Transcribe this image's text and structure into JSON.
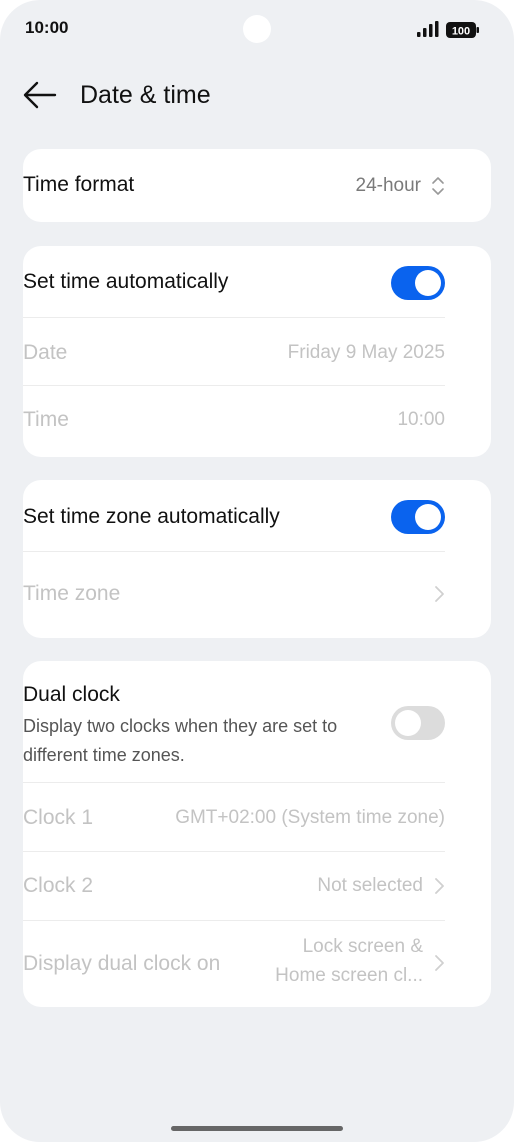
{
  "status_bar": {
    "time": "10:00",
    "battery": "100"
  },
  "header": {
    "title": "Date & time"
  },
  "time_format": {
    "label": "Time format",
    "value": "24-hour"
  },
  "auto_time": {
    "label": "Set time automatically",
    "enabled": true,
    "date_label": "Date",
    "date_value": "Friday 9 May 2025",
    "time_label": "Time",
    "time_value": "10:00"
  },
  "auto_zone": {
    "label": "Set time zone automatically",
    "enabled": true,
    "zone_label": "Time zone"
  },
  "dual_clock": {
    "label": "Dual clock",
    "description": "Display two clocks when they are set to different time zones.",
    "enabled": false,
    "clock1_label": "Clock 1",
    "clock1_value": "GMT+02:00 (System time zone)",
    "clock2_label": "Clock 2",
    "clock2_value": "Not selected",
    "display_label": "Display dual clock on",
    "display_value_line1": "Lock screen &",
    "display_value_line2": "Home screen cl..."
  },
  "colors": {
    "accent": "#0a63ee",
    "background": "#eef0f3",
    "card": "#ffffff",
    "disabled_text": "#c3c3c3"
  },
  "icons": [
    "back-arrow-icon",
    "updown-chevron-icon",
    "chevron-right-icon",
    "signal-icon",
    "battery-icon"
  ]
}
